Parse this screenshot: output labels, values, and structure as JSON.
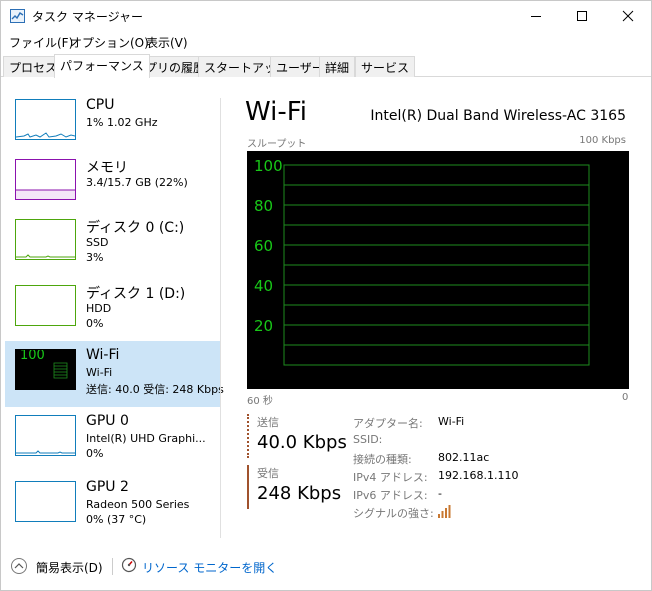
{
  "window": {
    "title": "タスク マネージャー"
  },
  "menu": [
    "ファイル(F)",
    "オプション(O)",
    "表示(V)"
  ],
  "tabs": [
    "プロセス",
    "パフォーマンス",
    "アプリの履歴",
    "スタートアップ",
    "ユーザー",
    "詳細",
    "サービス"
  ],
  "sidebar": {
    "items": [
      {
        "title": "CPU",
        "sub1": "1%  1.02 GHz",
        "sub2": ""
      },
      {
        "title": "メモリ",
        "sub1": "3.4/15.7 GB (22%)",
        "sub2": ""
      },
      {
        "title": "ディスク 0 (C:)",
        "sub1": "SSD",
        "sub2": "3%"
      },
      {
        "title": "ディスク 1 (D:)",
        "sub1": "HDD",
        "sub2": "0%"
      },
      {
        "title": "Wi-Fi",
        "sub1": "Wi-Fi",
        "sub2": "送信: 40.0  受信: 248 Kbps",
        "thumb_label": "100"
      },
      {
        "title": "GPU 0",
        "sub1": "Intel(R) UHD Graphi...",
        "sub2": "0%"
      },
      {
        "title": "GPU 2",
        "sub1": "Radeon 500 Series",
        "sub2": "0% (37 °C)"
      }
    ]
  },
  "main": {
    "title": "Wi-Fi",
    "adapter": "Intel(R) Dual Band Wireless-AC 3165",
    "graph_label": "スループット",
    "graph_max": "100 Kbps",
    "axis_left": "60 秒",
    "axis_right": "0",
    "y_ticks": [
      "100",
      "80",
      "60",
      "40",
      "20"
    ],
    "send_label": "送信",
    "send_value": "40.0 Kbps",
    "recv_label": "受信",
    "recv_value": "248 Kbps",
    "details": [
      {
        "key": "アダプター名:",
        "value": "Wi-Fi"
      },
      {
        "key": "SSID:",
        "value": ""
      },
      {
        "key": "接続の種類:",
        "value": "802.11ac"
      },
      {
        "key": "IPv4 アドレス:",
        "value": "192.168.1.110"
      },
      {
        "key": "IPv6 アドレス:",
        "value": "-"
      },
      {
        "key": "シグナルの強さ:",
        "value": ""
      }
    ],
    "signal_bars": 4
  },
  "footer": {
    "fewer_details": "簡易表示(D)",
    "resource_monitor": "リソース モニターを開く"
  },
  "colors": {
    "graph_grid": "#1e8c1e",
    "graph_label": "#18c818",
    "selected_bg": "#cce4f7",
    "link": "#0066cc"
  }
}
